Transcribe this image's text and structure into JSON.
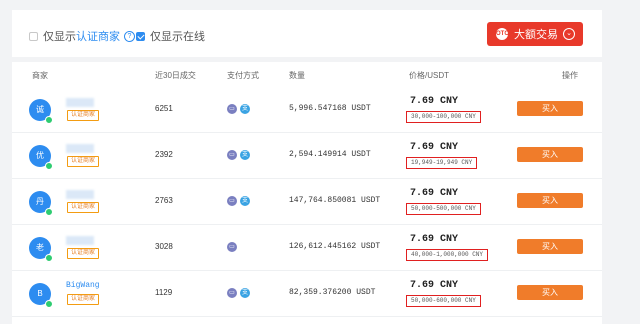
{
  "filters": {
    "certified_prefix": "仅显示",
    "certified_link": "认证商家",
    "help_icon_glyph": "?",
    "online_only_label": "仅显示在线",
    "certified_checked": false,
    "online_checked": true
  },
  "bulk": {
    "label": "大额交易",
    "icon_glyph": "OTC",
    "chevron_glyph": "⌄"
  },
  "columns": {
    "merchant": "商家",
    "deals_30d": "近30日成交",
    "payment": "支付方式",
    "quantity": "数量",
    "price": "价格/USDT",
    "action": "操作"
  },
  "rows": [
    {
      "avatar": "诚",
      "name": "",
      "badge": "认证商家",
      "deals": "6251",
      "qty": "5,996.547168 USDT",
      "price": "7.69  CNY",
      "limit": "30,000-100,000 CNY",
      "buy": "买入"
    },
    {
      "avatar": "优",
      "name": "",
      "badge": "认证商家",
      "deals": "2392",
      "qty": "2,594.149914 USDT",
      "price": "7.69  CNY",
      "limit": "19,949-19,949 CNY",
      "buy": "买入"
    },
    {
      "avatar": "丹",
      "name": "",
      "badge": "认证商家",
      "deals": "2763",
      "qty": "147,764.850081 USDT",
      "price": "7.69  CNY",
      "limit": "50,000-500,000 CNY",
      "buy": "买入"
    },
    {
      "avatar": "老",
      "name": "",
      "badge": "认证商家",
      "deals": "3028",
      "qty": "126,612.445162 USDT",
      "price": "7.69  CNY",
      "limit": "40,000-1,000,000 CNY",
      "buy": "买入"
    },
    {
      "avatar": "B",
      "name": "BigWang",
      "badge": "认证商家",
      "deals": "1129",
      "qty": "82,359.376200 USDT",
      "price": "7.69  CNY",
      "limit": "50,000-600,000 CNY",
      "buy": "买入"
    }
  ],
  "icons": {
    "bank_glyph": "▭",
    "alipay_glyph": "支"
  },
  "colors": {
    "accent_blue": "#2d8cf0",
    "bulk_red": "#e8392a",
    "buy_orange": "#f07c2a",
    "limit_box_red": "#e02020"
  }
}
